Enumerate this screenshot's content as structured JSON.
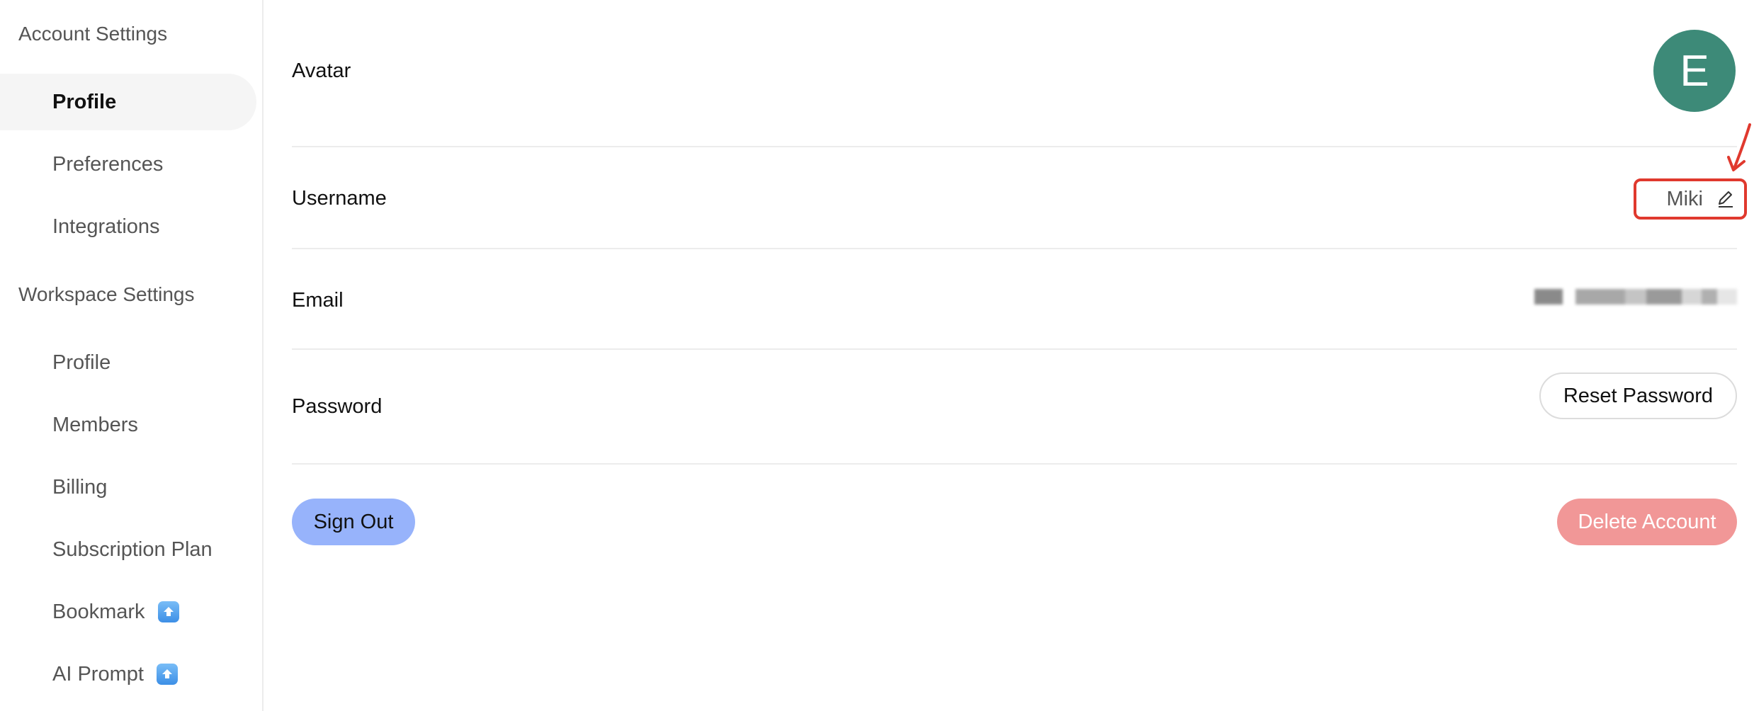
{
  "sidebar": {
    "account_section_title": "Account Settings",
    "account_items": [
      {
        "label": "Profile",
        "active": true
      },
      {
        "label": "Preferences"
      },
      {
        "label": "Integrations"
      }
    ],
    "workspace_section_title": "Workspace Settings",
    "workspace_items": [
      {
        "label": "Profile"
      },
      {
        "label": "Members"
      },
      {
        "label": "Billing"
      },
      {
        "label": "Subscription Plan"
      },
      {
        "label": "Bookmark",
        "icon": "upgrade-icon"
      },
      {
        "label": "AI Prompt",
        "icon": "upgrade-icon"
      }
    ]
  },
  "profile": {
    "avatar_label": "Avatar",
    "avatar_initial": "E",
    "avatar_color": "#3d8a78",
    "username_label": "Username",
    "username_value": "Miki",
    "email_label": "Email",
    "password_label": "Password",
    "reset_password_label": "Reset Password"
  },
  "actions": {
    "sign_out_label": "Sign Out",
    "delete_account_label": "Delete Account"
  },
  "colors": {
    "accent_blue": "#97b3fb",
    "danger_red": "#f19797",
    "annotation_red": "#e0392e"
  }
}
